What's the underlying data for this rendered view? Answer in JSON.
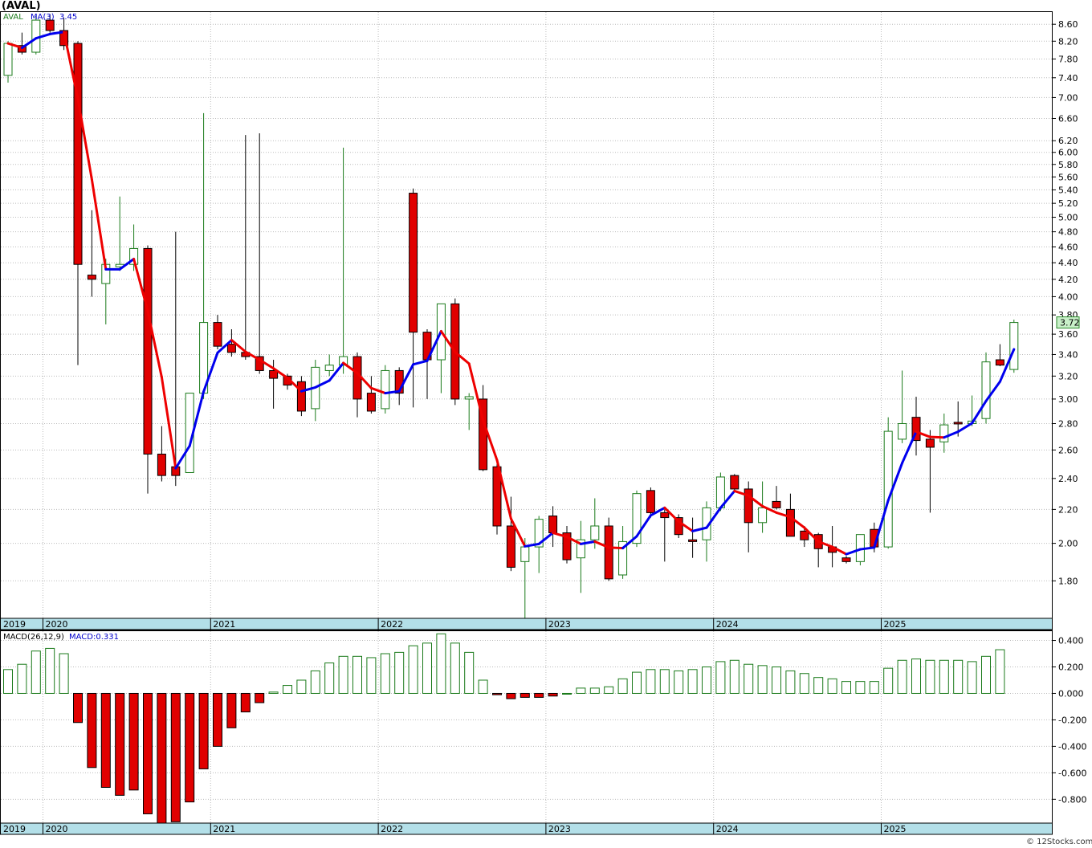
{
  "symbol_title": "(AVAL)",
  "watermark": "© 12Stocks.com",
  "price_panel": {
    "legend_symbol": "AVAL",
    "legend_ma": "MA(3)",
    "legend_ma_value": "3.45",
    "last_price_label": "3.72",
    "y_ticks": [
      "8.60",
      "8.20",
      "7.80",
      "7.40",
      "7.00",
      "6.60",
      "6.20",
      "6.00",
      "5.80",
      "5.60",
      "5.40",
      "5.20",
      "5.00",
      "4.80",
      "4.60",
      "4.40",
      "4.20",
      "4.00",
      "3.80",
      "3.60",
      "3.40",
      "3.20",
      "3.00",
      "2.80",
      "2.60",
      "2.40",
      "2.20",
      "2.00",
      "1.80"
    ]
  },
  "macd_panel": {
    "legend_name": "MACD(26,12,9)",
    "legend_value": "MACD:0.331",
    "y_ticks": [
      "0.400",
      "0.200",
      "0.000",
      "-0.200",
      "-0.400",
      "-0.600",
      "-0.800"
    ]
  },
  "x_axis": {
    "year_labels": [
      "2019",
      "2020",
      "2021",
      "2022",
      "2023",
      "2024",
      "2025"
    ]
  },
  "colors": {
    "up": "#1a7a1a",
    "down": "#e00000",
    "ma_up": "#0000ee",
    "ma_down": "#ee0000",
    "axis_band": "#b3dfe8",
    "grid": "#bbbbbb",
    "last_price_box": "#c8f0c8"
  },
  "chart_data": [
    {
      "type": "candlestick",
      "title": "(AVAL)",
      "interval": "monthly",
      "y_scale": "log",
      "ylim": [
        1.62,
        8.9
      ],
      "ma_period": 3,
      "ma_last": 3.45,
      "last_close": 3.72,
      "candles": [
        {
          "x": "2019-10",
          "o": 7.45,
          "h": 8.2,
          "l": 7.3,
          "c": 8.15
        },
        {
          "x": "2019-11",
          "o": 8.1,
          "h": 8.4,
          "l": 7.9,
          "c": 7.95
        },
        {
          "x": "2019-12",
          "o": 7.95,
          "h": 8.8,
          "l": 7.9,
          "c": 8.7
        },
        {
          "x": "2020-01",
          "o": 8.7,
          "h": 8.85,
          "l": 8.4,
          "c": 8.45
        },
        {
          "x": "2020-02",
          "o": 8.45,
          "h": 8.75,
          "l": 8.0,
          "c": 8.1
        },
        {
          "x": "2020-03",
          "o": 8.15,
          "h": 8.2,
          "l": 3.3,
          "c": 4.38
        },
        {
          "x": "2020-04",
          "o": 4.25,
          "h": 5.1,
          "l": 4.0,
          "c": 4.2
        },
        {
          "x": "2020-05",
          "o": 4.15,
          "h": 4.45,
          "l": 3.7,
          "c": 4.38
        },
        {
          "x": "2020-06",
          "o": 4.35,
          "h": 5.3,
          "l": 4.3,
          "c": 4.38
        },
        {
          "x": "2020-07",
          "o": 4.38,
          "h": 4.9,
          "l": 4.3,
          "c": 4.58
        },
        {
          "x": "2020-08",
          "o": 4.58,
          "h": 4.62,
          "l": 2.3,
          "c": 2.57
        },
        {
          "x": "2020-09",
          "o": 2.57,
          "h": 2.78,
          "l": 2.38,
          "c": 2.42
        },
        {
          "x": "2020-10",
          "o": 2.48,
          "h": 4.8,
          "l": 2.35,
          "c": 2.42
        },
        {
          "x": "2020-11",
          "o": 2.44,
          "h": 3.05,
          "l": 2.44,
          "c": 3.05
        },
        {
          "x": "2020-12",
          "o": 3.05,
          "h": 6.7,
          "l": 3.0,
          "c": 3.72
        },
        {
          "x": "2021-01",
          "o": 3.72,
          "h": 3.8,
          "l": 3.45,
          "c": 3.48
        },
        {
          "x": "2021-02",
          "o": 3.5,
          "h": 3.65,
          "l": 3.38,
          "c": 3.42
        },
        {
          "x": "2021-03",
          "o": 3.42,
          "h": 6.3,
          "l": 3.35,
          "c": 3.38
        },
        {
          "x": "2021-04",
          "o": 3.38,
          "h": 6.33,
          "l": 3.22,
          "c": 3.25
        },
        {
          "x": "2021-05",
          "o": 3.25,
          "h": 3.35,
          "l": 2.92,
          "c": 3.18
        },
        {
          "x": "2021-06",
          "o": 3.2,
          "h": 3.22,
          "l": 3.08,
          "c": 3.12
        },
        {
          "x": "2021-07",
          "o": 3.15,
          "h": 3.2,
          "l": 2.86,
          "c": 2.9
        },
        {
          "x": "2021-08",
          "o": 2.92,
          "h": 3.35,
          "l": 2.82,
          "c": 3.28
        },
        {
          "x": "2021-09",
          "o": 3.25,
          "h": 3.4,
          "l": 3.2,
          "c": 3.3
        },
        {
          "x": "2021-10",
          "o": 3.3,
          "h": 6.08,
          "l": 3.22,
          "c": 3.38
        },
        {
          "x": "2021-11",
          "o": 3.38,
          "h": 3.42,
          "l": 2.85,
          "c": 3.0
        },
        {
          "x": "2021-12",
          "o": 3.05,
          "h": 3.2,
          "l": 2.88,
          "c": 2.9
        },
        {
          "x": "2022-01",
          "o": 2.92,
          "h": 3.3,
          "l": 2.88,
          "c": 3.25
        },
        {
          "x": "2022-02",
          "o": 3.25,
          "h": 3.28,
          "l": 2.95,
          "c": 3.05
        },
        {
          "x": "2022-03",
          "o": 5.35,
          "h": 5.42,
          "l": 2.93,
          "c": 3.62
        },
        {
          "x": "2022-04",
          "o": 3.62,
          "h": 3.65,
          "l": 3.0,
          "c": 3.35
        },
        {
          "x": "2022-05",
          "o": 3.35,
          "h": 3.92,
          "l": 3.05,
          "c": 3.92
        },
        {
          "x": "2022-06",
          "o": 3.92,
          "h": 3.98,
          "l": 2.95,
          "c": 3.0
        },
        {
          "x": "2022-07",
          "o": 3.0,
          "h": 3.05,
          "l": 2.75,
          "c": 3.02
        },
        {
          "x": "2022-08",
          "o": 3.0,
          "h": 3.12,
          "l": 2.45,
          "c": 2.46
        },
        {
          "x": "2022-09",
          "o": 2.48,
          "h": 2.5,
          "l": 2.05,
          "c": 2.1
        },
        {
          "x": "2022-10",
          "o": 2.1,
          "h": 2.28,
          "l": 1.85,
          "c": 1.87
        },
        {
          "x": "2022-11",
          "o": 1.9,
          "h": 2.03,
          "l": 1.62,
          "c": 1.98
        },
        {
          "x": "2022-12",
          "o": 1.98,
          "h": 2.16,
          "l": 1.84,
          "c": 2.14
        },
        {
          "x": "2023-01",
          "o": 2.16,
          "h": 2.22,
          "l": 1.98,
          "c": 2.06
        },
        {
          "x": "2023-02",
          "o": 2.06,
          "h": 2.1,
          "l": 1.89,
          "c": 1.91
        },
        {
          "x": "2023-03",
          "o": 1.92,
          "h": 2.13,
          "l": 1.74,
          "c": 2.02
        },
        {
          "x": "2023-04",
          "o": 2.02,
          "h": 2.27,
          "l": 1.97,
          "c": 2.1
        },
        {
          "x": "2023-05",
          "o": 2.1,
          "h": 2.15,
          "l": 1.8,
          "c": 1.81
        },
        {
          "x": "2023-06",
          "o": 1.83,
          "h": 2.1,
          "l": 1.81,
          "c": 2.01
        },
        {
          "x": "2023-07",
          "o": 2.0,
          "h": 2.32,
          "l": 1.98,
          "c": 2.3
        },
        {
          "x": "2023-08",
          "o": 2.32,
          "h": 2.34,
          "l": 2.15,
          "c": 2.18
        },
        {
          "x": "2023-09",
          "o": 2.18,
          "h": 2.2,
          "l": 1.9,
          "c": 2.15
        },
        {
          "x": "2023-10",
          "o": 2.15,
          "h": 2.17,
          "l": 2.03,
          "c": 2.05
        },
        {
          "x": "2023-11",
          "o": 2.02,
          "h": 2.15,
          "l": 1.92,
          "c": 2.01
        },
        {
          "x": "2023-12",
          "o": 2.02,
          "h": 2.25,
          "l": 1.9,
          "c": 2.21
        },
        {
          "x": "2024-01",
          "o": 2.21,
          "h": 2.44,
          "l": 2.19,
          "c": 2.41
        },
        {
          "x": "2024-02",
          "o": 2.42,
          "h": 2.43,
          "l": 2.32,
          "c": 2.33
        },
        {
          "x": "2024-03",
          "o": 2.33,
          "h": 2.38,
          "l": 1.95,
          "c": 2.12
        },
        {
          "x": "2024-04",
          "o": 2.12,
          "h": 2.38,
          "l": 2.06,
          "c": 2.21
        },
        {
          "x": "2024-05",
          "o": 2.25,
          "h": 2.35,
          "l": 2.2,
          "c": 2.21
        },
        {
          "x": "2024-06",
          "o": 2.2,
          "h": 2.3,
          "l": 2.04,
          "c": 2.04
        },
        {
          "x": "2024-07",
          "o": 2.07,
          "h": 2.1,
          "l": 1.98,
          "c": 2.02
        },
        {
          "x": "2024-08",
          "o": 2.05,
          "h": 2.06,
          "l": 1.87,
          "c": 1.97
        },
        {
          "x": "2024-09",
          "o": 1.98,
          "h": 2.1,
          "l": 1.87,
          "c": 1.95
        },
        {
          "x": "2024-10",
          "o": 1.92,
          "h": 1.93,
          "l": 1.89,
          "c": 1.9
        },
        {
          "x": "2024-11",
          "o": 1.9,
          "h": 2.05,
          "l": 1.88,
          "c": 2.05
        },
        {
          "x": "2024-12",
          "o": 2.08,
          "h": 2.12,
          "l": 1.95,
          "c": 1.98
        },
        {
          "x": "2025-01",
          "o": 1.98,
          "h": 2.85,
          "l": 1.97,
          "c": 2.74
        },
        {
          "x": "2025-02",
          "o": 2.68,
          "h": 3.25,
          "l": 2.65,
          "c": 2.8
        },
        {
          "x": "2025-03",
          "o": 2.85,
          "h": 3.02,
          "l": 2.56,
          "c": 2.67
        },
        {
          "x": "2025-04",
          "o": 2.68,
          "h": 2.75,
          "l": 2.18,
          "c": 2.62
        },
        {
          "x": "2025-05",
          "o": 2.66,
          "h": 2.88,
          "l": 2.58,
          "c": 2.79
        },
        {
          "x": "2025-06",
          "o": 2.81,
          "h": 2.98,
          "l": 2.7,
          "c": 2.8
        },
        {
          "x": "2025-07",
          "o": 2.8,
          "h": 3.03,
          "l": 2.78,
          "c": 2.82
        },
        {
          "x": "2025-08",
          "o": 2.84,
          "h": 3.42,
          "l": 2.8,
          "c": 3.33
        },
        {
          "x": "2025-09",
          "o": 3.35,
          "h": 3.5,
          "l": 3.29,
          "c": 3.3
        },
        {
          "x": "2025-10",
          "o": 3.26,
          "h": 3.75,
          "l": 3.23,
          "c": 3.72
        }
      ]
    },
    {
      "type": "bar",
      "title": "MACD(26,12,9)",
      "ylim": [
        -0.98,
        0.47
      ],
      "last_value": 0.331,
      "values": [
        0.18,
        0.22,
        0.32,
        0.34,
        0.3,
        -0.22,
        -0.56,
        -0.71,
        -0.77,
        -0.73,
        -0.91,
        -0.98,
        -0.97,
        -0.82,
        -0.57,
        -0.4,
        -0.26,
        -0.14,
        -0.07,
        0.01,
        0.06,
        0.1,
        0.17,
        0.23,
        0.28,
        0.28,
        0.27,
        0.3,
        0.31,
        0.36,
        0.38,
        0.45,
        0.38,
        0.31,
        0.1,
        -0.01,
        -0.04,
        -0.03,
        -0.03,
        -0.02,
        0.0,
        0.04,
        0.04,
        0.05,
        0.11,
        0.16,
        0.18,
        0.18,
        0.17,
        0.18,
        0.2,
        0.24,
        0.25,
        0.22,
        0.21,
        0.2,
        0.17,
        0.15,
        0.12,
        0.11,
        0.09,
        0.09,
        0.09,
        0.19,
        0.25,
        0.26,
        0.25,
        0.25,
        0.25,
        0.24,
        0.28,
        0.33
      ]
    }
  ]
}
